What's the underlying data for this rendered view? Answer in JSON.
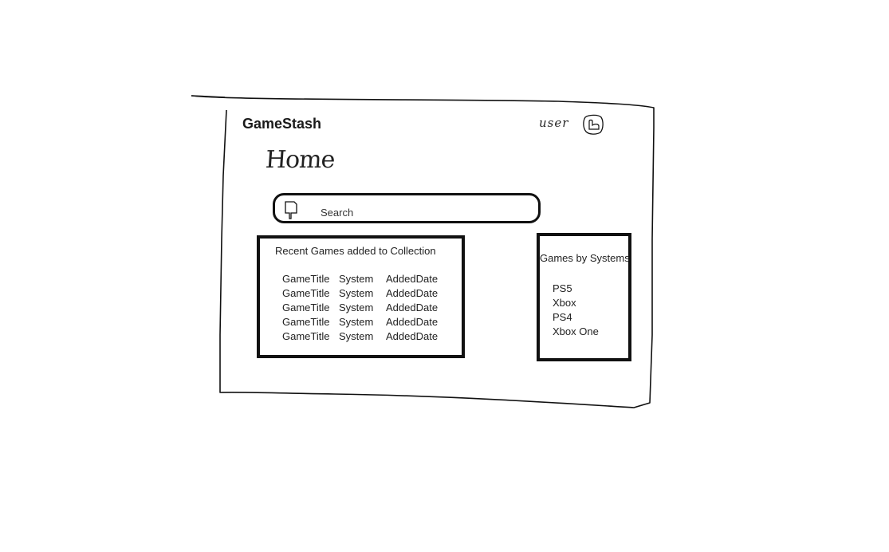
{
  "header": {
    "app_title": "GameStash",
    "user_label": "user",
    "avatar_icon": "user-avatar-icon"
  },
  "page": {
    "heading": "Home"
  },
  "search": {
    "placeholder": "Search",
    "icon": "search-icon"
  },
  "recent_games": {
    "title": "Recent Games added to Collection",
    "rows": [
      {
        "title": "GameTitle",
        "system": "System",
        "added_date": "AddedDate"
      },
      {
        "title": "GameTitle",
        "system": "System",
        "added_date": "AddedDate"
      },
      {
        "title": "GameTitle",
        "system": "System",
        "added_date": "AddedDate"
      },
      {
        "title": "GameTitle",
        "system": "System",
        "added_date": "AddedDate"
      },
      {
        "title": "GameTitle",
        "system": "System",
        "added_date": "AddedDate"
      }
    ]
  },
  "systems": {
    "title": "Games by Systems",
    "items": [
      "PS5",
      "Xbox",
      "PS4",
      "Xbox One"
    ]
  }
}
